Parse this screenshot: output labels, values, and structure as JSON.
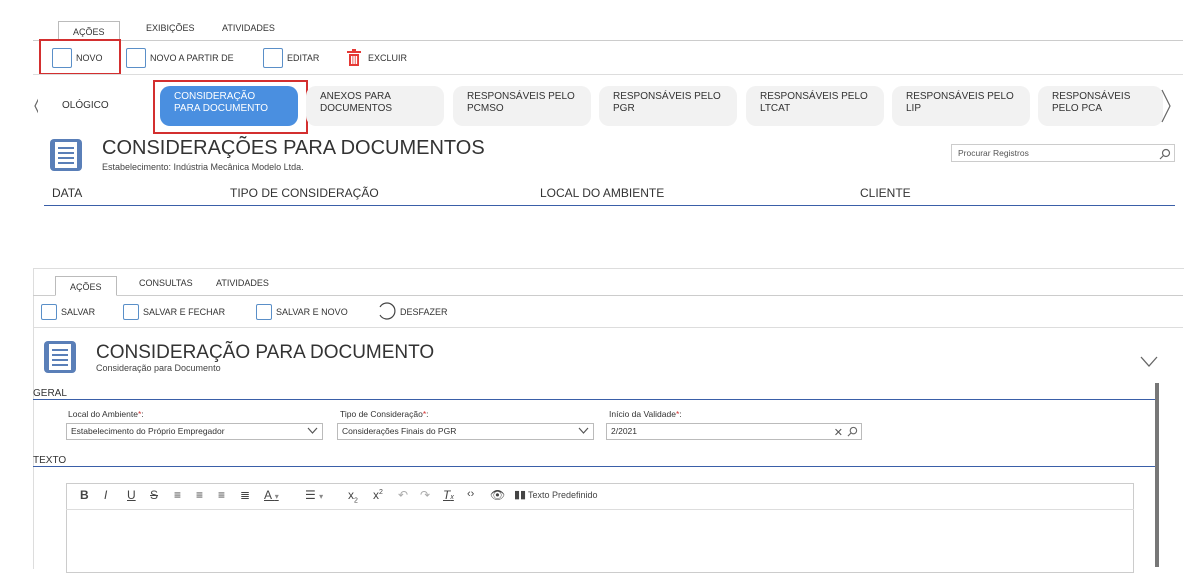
{
  "top": {
    "tabs": [
      "AÇÕES",
      "EXIBIÇÕES",
      "ATIVIDADES"
    ],
    "toolbar": {
      "novo": "NOVO",
      "novo_a_partir": "NOVO A PARTIR DE",
      "editar": "EDITAR",
      "excluir": "EXCLUIR"
    },
    "chips": [
      "OLÓGICO",
      "CONSIDERAÇÃO PARA DOCUMENTO",
      "ANEXOS PARA DOCUMENTOS",
      "RESPONSÁVEIS PELO PCMSO",
      "RESPONSÁVEIS PELO PGR",
      "RESPONSÁVEIS PELO LTCAT",
      "RESPONSÁVEIS PELO LIP",
      "RESPONSÁVEIS PELO PCA"
    ],
    "title": "CONSIDERAÇÕES PARA DOCUMENTOS",
    "subtitle": "Estabelecimento: Indústria Mecânica Modelo Ltda.",
    "search_placeholder": "Procurar Registros",
    "columns": [
      "DATA",
      "TIPO DE CONSIDERAÇÃO",
      "LOCAL DO AMBIENTE",
      "CLIENTE"
    ]
  },
  "bottom": {
    "tabs": [
      "AÇÕES",
      "CONSULTAS",
      "ATIVIDADES"
    ],
    "toolbar": {
      "salvar": "SALVAR",
      "salvar_fechar": "SALVAR E FECHAR",
      "salvar_novo": "SALVAR E NOVO",
      "desfazer": "DESFAZER"
    },
    "title": "CONSIDERAÇÃO PARA DOCUMENTO",
    "subtitle": "Consideração para Documento",
    "section_geral": "GERAL",
    "section_texto": "TEXTO",
    "fields": {
      "local_label": "Local do Ambiente",
      "local_value": "Estabelecimento do Próprio Empregador",
      "tipo_label": "Tipo de Consideração",
      "tipo_value": "Considerações Finais do PGR",
      "inicio_label": "Início da Validade",
      "inicio_value": "2/2021"
    },
    "editor": {
      "predef": "Texto Predefinido"
    }
  },
  "colors": {
    "accent": "#4a8fe0",
    "highlight": "#d32f2f",
    "line": "#3a5fa8"
  }
}
